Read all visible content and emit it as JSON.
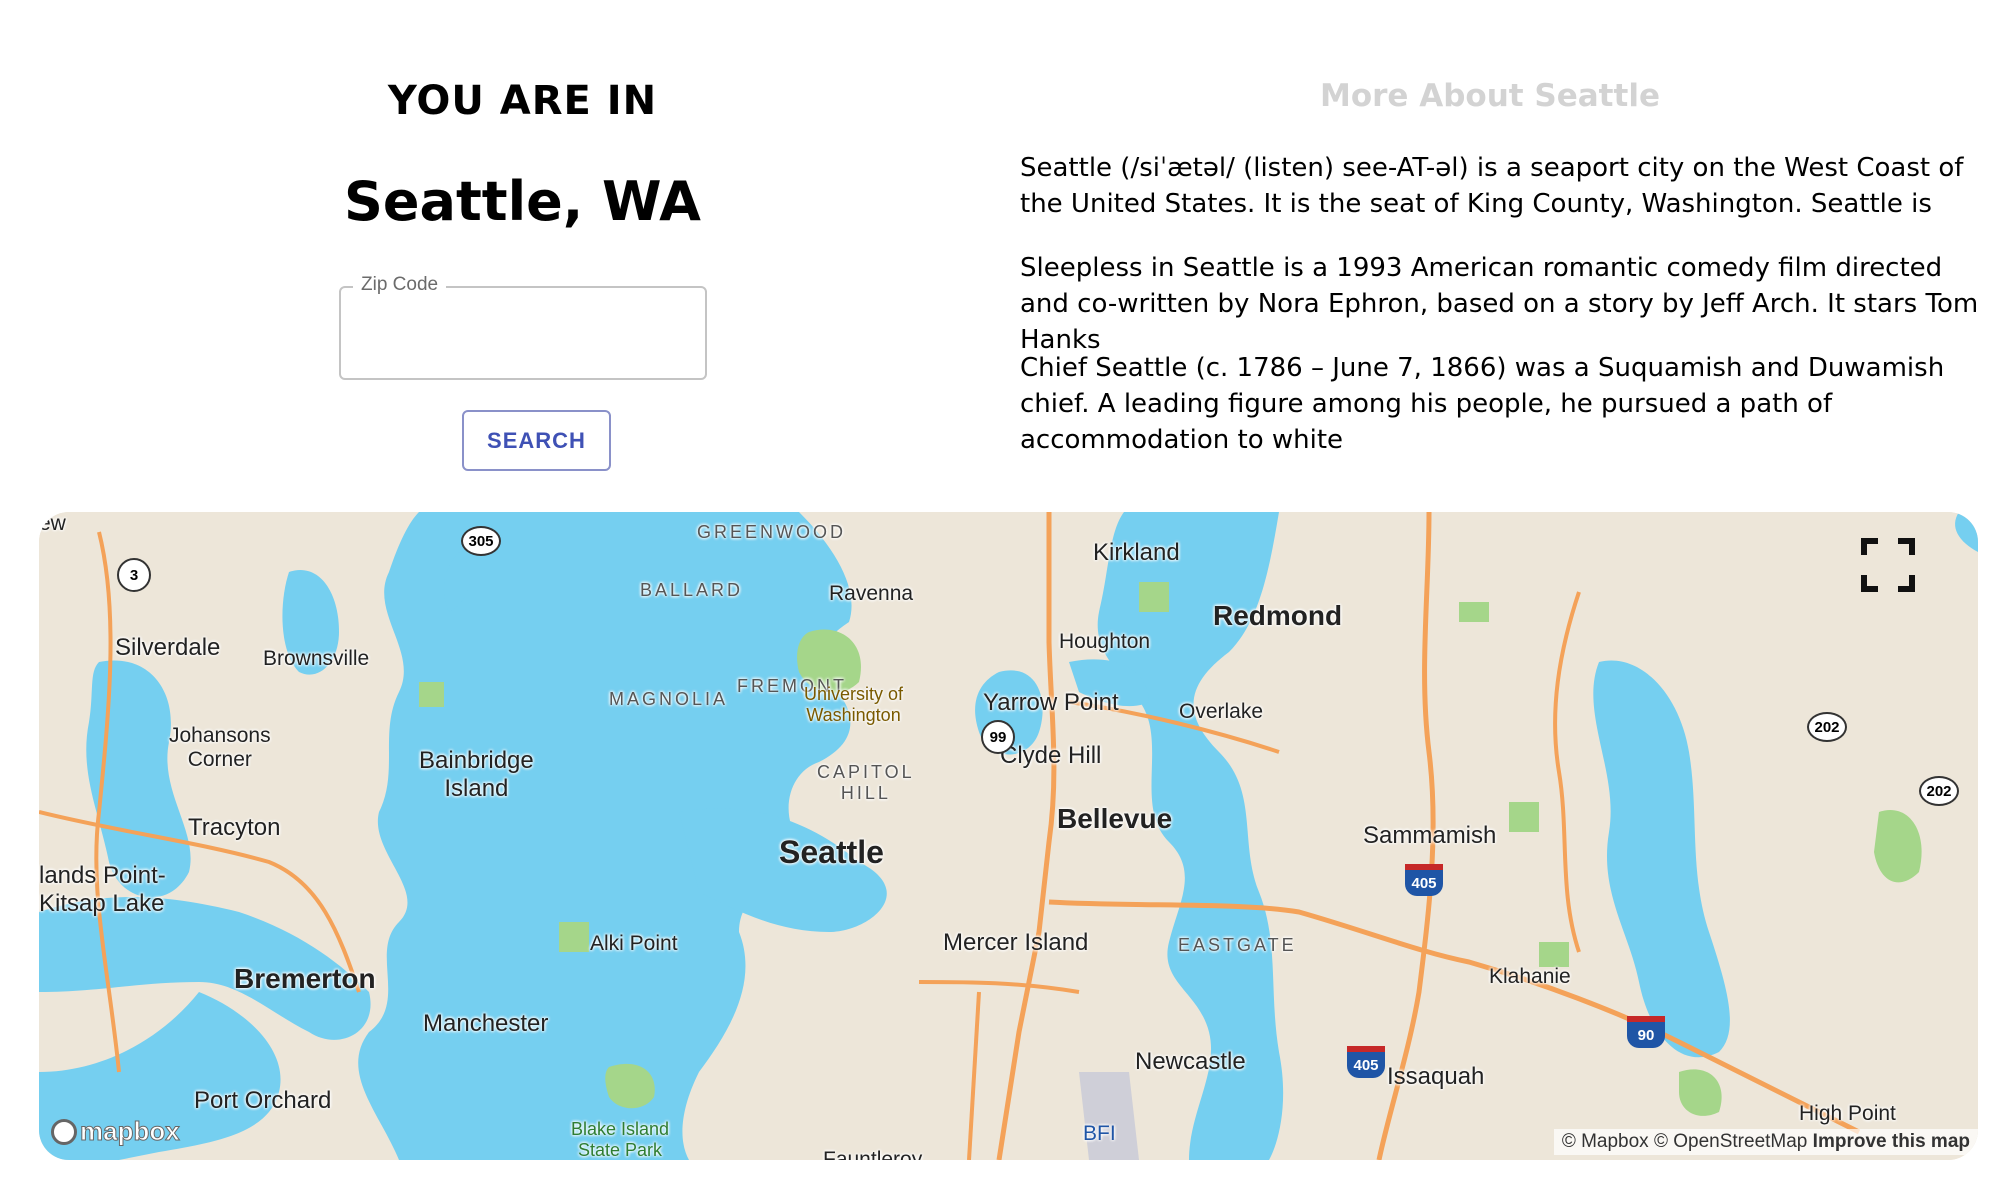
{
  "location": {
    "heading": "YOU ARE IN",
    "city": "Seattle, WA"
  },
  "search": {
    "zip_label": "Zip Code",
    "zip_value": "",
    "button_label": "SEARCH"
  },
  "about": {
    "title": "More About Seattle",
    "paragraphs": [
      "Seattle (/siˈætəl/ (listen) see-AT-əl) is a seaport city on the West Coast of the United States. It is the seat of King County, Washington. Seattle is",
      "Sleepless in Seattle is a 1993 American romantic comedy film directed and co-written by Nora Ephron, based on a story by Jeff Arch. It stars Tom Hanks",
      "Chief Seattle (c. 1786 – June 7, 1866) was a Suquamish and Duwamish chief. A leading figure among his people, he pursued a path of accommodation to white"
    ]
  },
  "map": {
    "logo": "mapbox",
    "attribution": {
      "mapbox": "© Mapbox",
      "osm": "© OpenStreetMap",
      "improve": "Improve this map"
    },
    "labels": {
      "greenwood": "GREENWOOD",
      "ballard": "BALLARD",
      "ravenna": "Ravenna",
      "kirkland": "Kirkland",
      "redmond": "Redmond",
      "houghton": "Houghton",
      "silverdale": "Silverdale",
      "brownsville": "Brownsville",
      "magnolia": "MAGNOLIA",
      "fremont": "FREMONT",
      "uw": "University of\nWashington",
      "yarrow_point": "Yarrow Point",
      "overlake": "Overlake",
      "johansons_corner": "Johansons\nCorner",
      "bainbridge_island": "Bainbridge\nIsland",
      "capitol_hill": "CAPITOL\nHILL",
      "clyde_hill": "Clyde Hill",
      "tracyton": "Tracyton",
      "bellevue": "Bellevue",
      "sammamish": "Sammamish",
      "seattle": "Seattle",
      "islands_point": "lands Point-",
      "kitsap_lake": "Kitsap Lake",
      "alki_point": "Alki Point",
      "mercer_island": "Mercer Island",
      "eastgate": "EASTGATE",
      "klahanie": "Klahanie",
      "bremerton": "Bremerton",
      "manchester": "Manchester",
      "newcastle": "Newcastle",
      "issaquah": "Issaquah",
      "port_orchard": "Port Orchard",
      "blake_island": "Blake Island\nState Park",
      "bfi": "BFI",
      "fauntleroy": "Fauntleroy",
      "high_point": "High Point",
      "ew": "ew"
    },
    "shields": {
      "sr3": "3",
      "sr305": "305",
      "sr99": "99",
      "sr202a": "202",
      "sr202b": "202",
      "i405a": "405",
      "i405b": "405",
      "i90": "90"
    },
    "colors": {
      "water": "#75cff0",
      "land": "#ede6d9",
      "park": "#a5d68a",
      "highway": "#f4a259"
    }
  }
}
